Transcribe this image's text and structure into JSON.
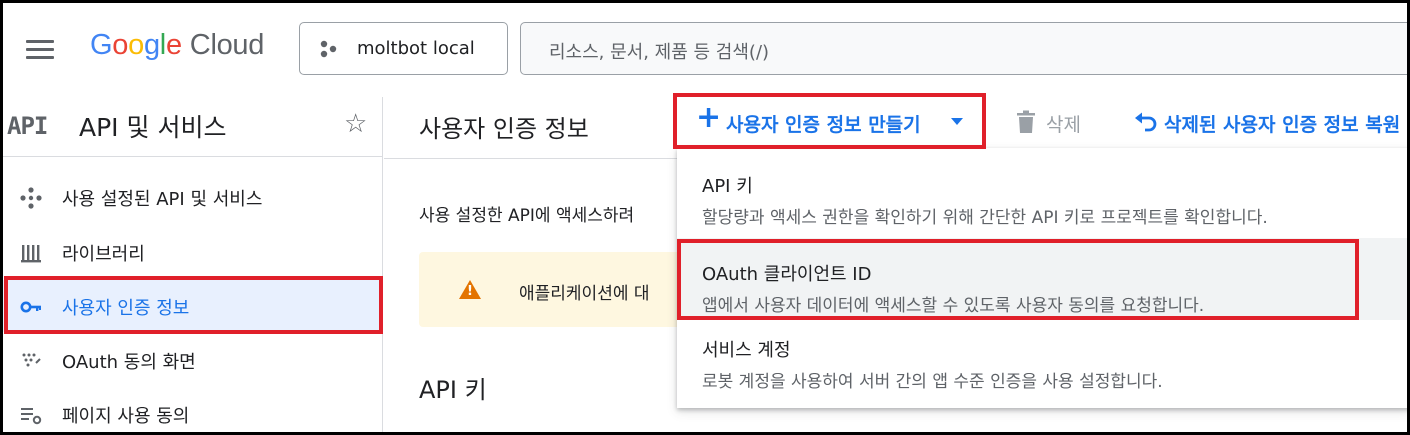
{
  "topbar": {
    "logo_google": "Google",
    "logo_cloud": "Cloud",
    "project_name": "moltbot local",
    "search_placeholder": "리소스, 문서, 제품 등 검색(/)"
  },
  "sidebar": {
    "api_badge": "API",
    "title": "API 및 서비스",
    "items": [
      {
        "label": "사용 설정된 API 및 서비스",
        "icon": "api-diamond-icon",
        "active": false
      },
      {
        "label": "라이브러리",
        "icon": "library-icon",
        "active": false
      },
      {
        "label": "사용자 인증 정보",
        "icon": "key-icon",
        "active": true
      },
      {
        "label": "OAuth 동의 화면",
        "icon": "consent-dots-icon",
        "active": false
      },
      {
        "label": "페이지 사용 동의",
        "icon": "settings-list-icon",
        "active": false
      }
    ]
  },
  "main": {
    "page_title": "사용자 인증 정보",
    "create_label": "사용자 인증 정보 만들기",
    "delete_label": "삭제",
    "restore_label": "삭제된 사용자 인증 정보 복원",
    "description": "사용 설정한 API에 액세스하려",
    "warning_text": "애플리케이션에 대",
    "section_title": "API 키"
  },
  "dropdown": {
    "items": [
      {
        "title": "API 키",
        "desc": "할당량과 액세스 권한을 확인하기 위해 간단한 API 키로 프로젝트를 확인합니다."
      },
      {
        "title": "OAuth 클라이언트 ID",
        "desc": "앱에서 사용자 데이터에 액세스할 수 있도록 사용자 동의를 요청합니다."
      },
      {
        "title": "서비스 계정",
        "desc": "로봇 계정을 사용하여 서버 간의 앱 수준 인증을 사용 설정합니다."
      }
    ]
  },
  "colors": {
    "accent": "#1a73e8",
    "highlight": "#e0202a",
    "warning": "#e37400",
    "warning_bg": "#fef7e0"
  }
}
